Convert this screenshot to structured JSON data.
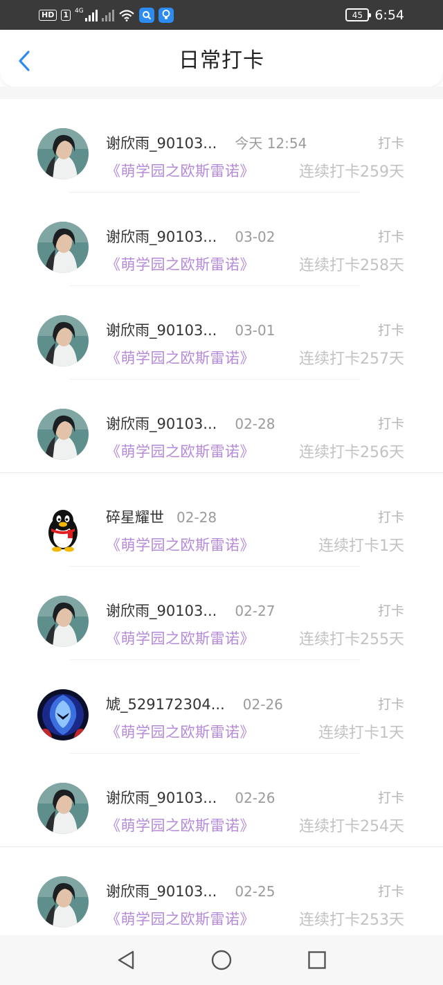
{
  "status_bar": {
    "hd_label": "HD",
    "hd_sim": "1",
    "net_label": "4G",
    "battery": "45",
    "time": "6:54"
  },
  "header": {
    "title": "日常打卡",
    "back_icon": "chevron-left-icon",
    "accent": "#2d8cf0"
  },
  "checkins": [
    {
      "user": "谢欣雨_90103...",
      "time": "今天 12:54",
      "action": "打卡",
      "book": "《萌学园之欧斯雷诺》",
      "streak": "连续打卡259天",
      "avatar": "portrait"
    },
    {
      "user": "谢欣雨_90103...",
      "time": "03-02",
      "action": "打卡",
      "book": "《萌学园之欧斯雷诺》",
      "streak": "连续打卡258天",
      "avatar": "portrait"
    },
    {
      "user": "谢欣雨_90103...",
      "time": "03-01",
      "action": "打卡",
      "book": "《萌学园之欧斯雷诺》",
      "streak": "连续打卡257天",
      "avatar": "portrait"
    },
    {
      "user": "谢欣雨_90103...",
      "time": "02-28",
      "action": "打卡",
      "book": "《萌学园之欧斯雷诺》",
      "streak": "连续打卡256天",
      "avatar": "portrait"
    },
    {
      "user": "碎星耀世",
      "time": "02-28",
      "action": "打卡",
      "book": "《萌学园之欧斯雷诺》",
      "streak": "连续打卡1天",
      "avatar": "penguin"
    },
    {
      "user": "谢欣雨_90103...",
      "time": "02-27",
      "action": "打卡",
      "book": "《萌学园之欧斯雷诺》",
      "streak": "连续打卡255天",
      "avatar": "portrait"
    },
    {
      "user": "虓_529172304...",
      "time": "02-26",
      "action": "打卡",
      "book": "《萌学园之欧斯雷诺》",
      "streak": "连续打卡1天",
      "avatar": "armor"
    },
    {
      "user": "谢欣雨_90103...",
      "time": "02-26",
      "action": "打卡",
      "book": "《萌学园之欧斯雷诺》",
      "streak": "连续打卡254天",
      "avatar": "portrait"
    },
    {
      "user": "谢欣雨_90103...",
      "time": "02-25",
      "action": "打卡",
      "book": "《萌学园之欧斯雷诺》",
      "streak": "连续打卡253天",
      "avatar": "portrait"
    }
  ],
  "colors": {
    "book_title": "#b58ad8",
    "streak": "#c2c2c2",
    "time": "#9b9b9b"
  },
  "nav": {
    "back": "triangle-back-icon",
    "home": "circle-home-icon",
    "recent": "square-recent-icon"
  }
}
